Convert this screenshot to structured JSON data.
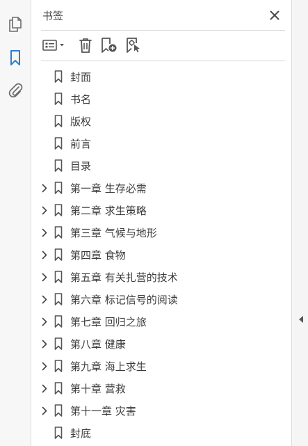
{
  "panel": {
    "title": "书签"
  },
  "rail": {
    "icons": [
      "pages-icon",
      "bookmark-icon",
      "attachment-icon"
    ],
    "active_color": "#2d7bd1"
  },
  "toolbar": {
    "icons": [
      "options-menu-icon",
      "delete-icon",
      "new-bookmark-icon",
      "new-bookmark-from-structure-icon"
    ]
  },
  "bookmarks": [
    {
      "label": "封面",
      "expandable": false
    },
    {
      "label": "书名",
      "expandable": false
    },
    {
      "label": "版权",
      "expandable": false
    },
    {
      "label": "前言",
      "expandable": false
    },
    {
      "label": "目录",
      "expandable": false
    },
    {
      "label": "第一章  生存必需",
      "expandable": true
    },
    {
      "label": "第二章  求生策略",
      "expandable": true
    },
    {
      "label": "第三章  气候与地形",
      "expandable": true
    },
    {
      "label": "第四章  食物",
      "expandable": true
    },
    {
      "label": "第五章  有关扎营的技术",
      "expandable": true
    },
    {
      "label": "第六章  标记信号的阅读",
      "expandable": true
    },
    {
      "label": "第七章  回归之旅",
      "expandable": true
    },
    {
      "label": "第八章  健康",
      "expandable": true
    },
    {
      "label": "第九章  海上求生",
      "expandable": true
    },
    {
      "label": "第十章  营救",
      "expandable": true
    },
    {
      "label": "第十一章  灾害",
      "expandable": true
    },
    {
      "label": "封底",
      "expandable": false
    }
  ]
}
